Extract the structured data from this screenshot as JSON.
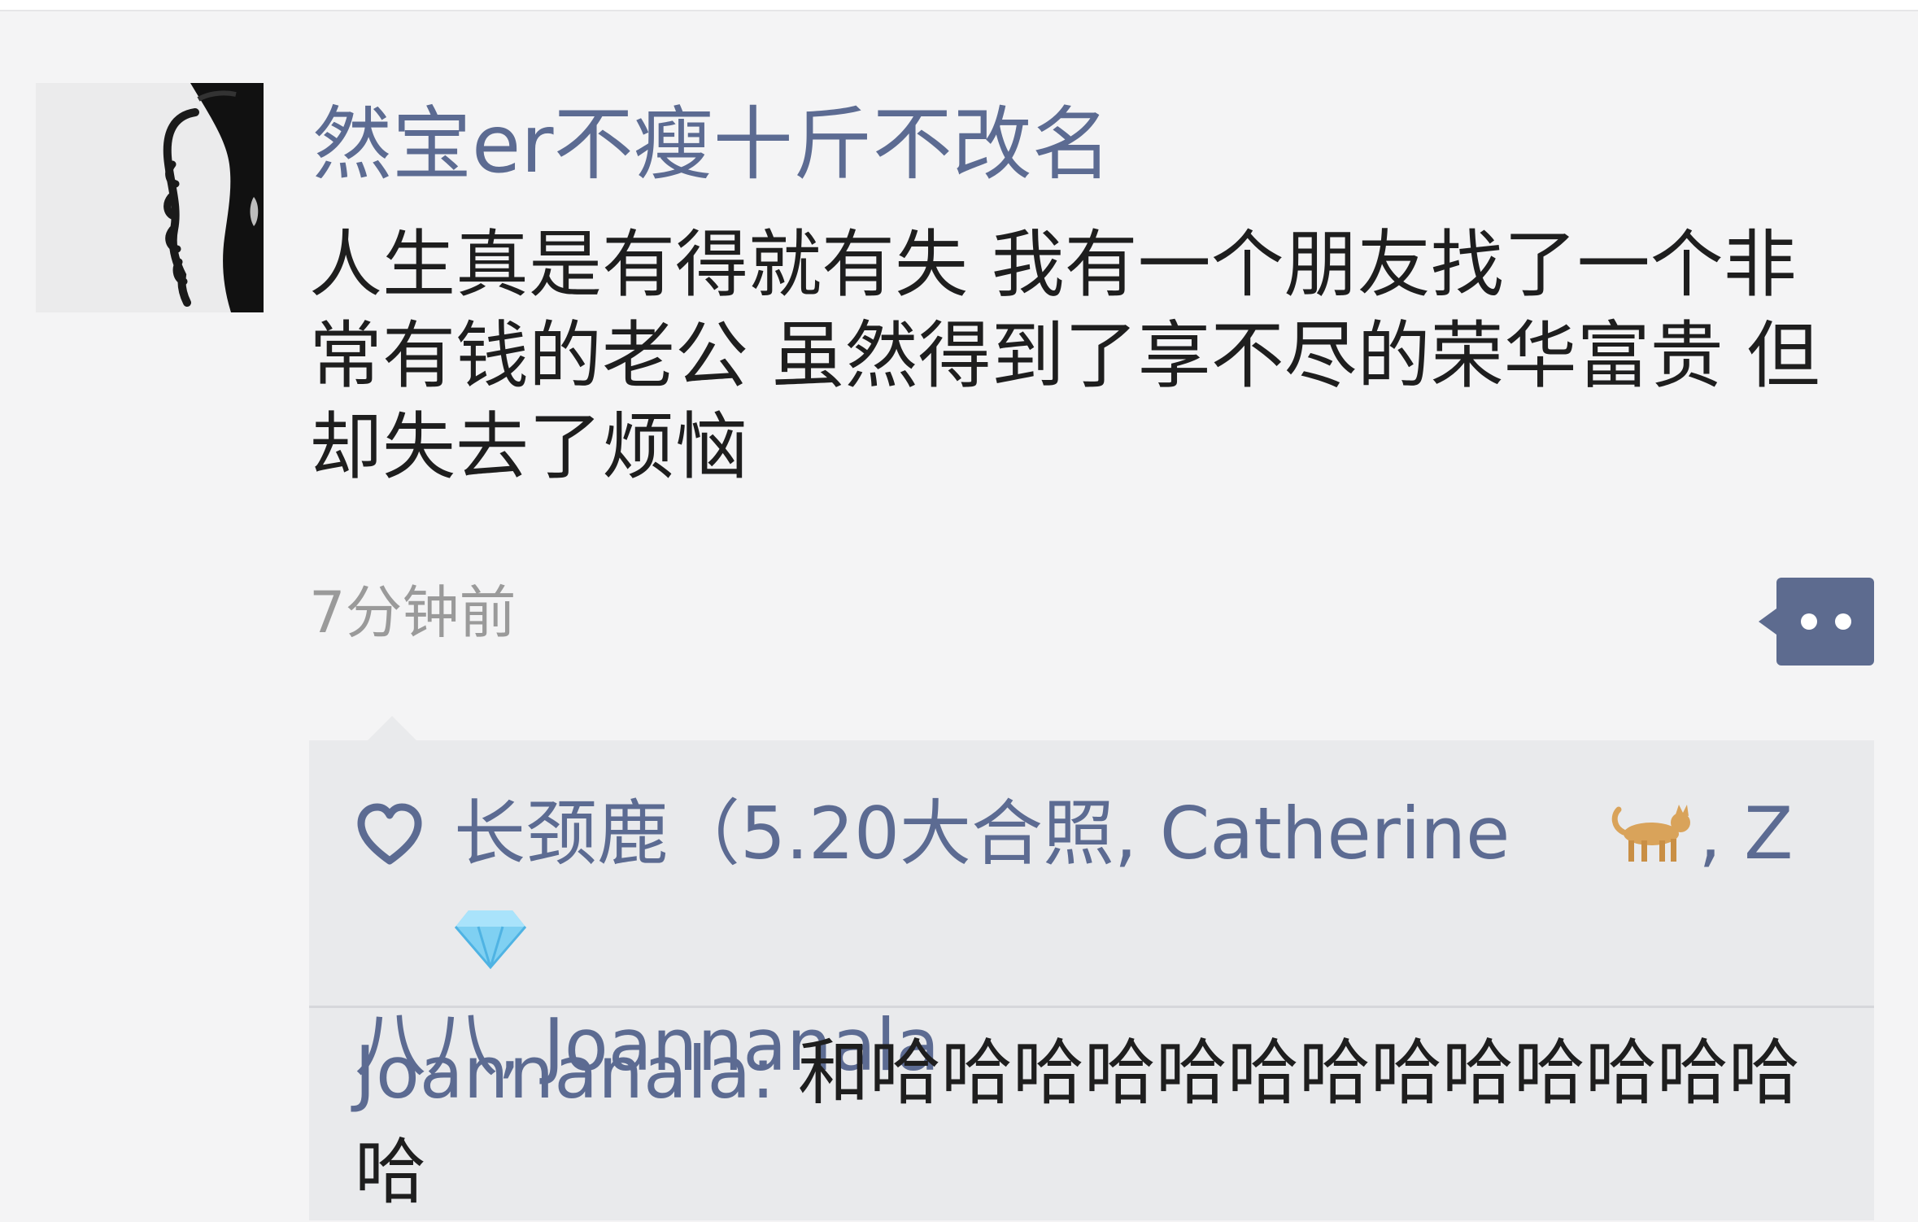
{
  "post": {
    "username": "然宝er不瘦十斤不改名",
    "content": "人生真是有得就有失 我有一个朋友找了一个非常有钱的老公 虽然得到了享不尽的荣华富贵 但却失去了烦恼",
    "timestamp": "7分钟前"
  },
  "likes": {
    "names_part1": "长颈鹿（5.20大合照, Catherine",
    "cat_emoji": "cat-icon",
    "names_part2": ", Z ",
    "gem_emoji": "gem-icon",
    "names_part3": "八八, Joannanala"
  },
  "comments": [
    {
      "author": "Joannanala",
      "separator": ": ",
      "text": "和哈哈哈哈哈哈哈哈哈哈哈哈哈哈"
    }
  ],
  "colors": {
    "link": "#5c6b92",
    "text": "#1e1e1e",
    "timestamp": "#9a9a9a",
    "panel": "#e9eaec",
    "background": "#f4f4f5"
  }
}
